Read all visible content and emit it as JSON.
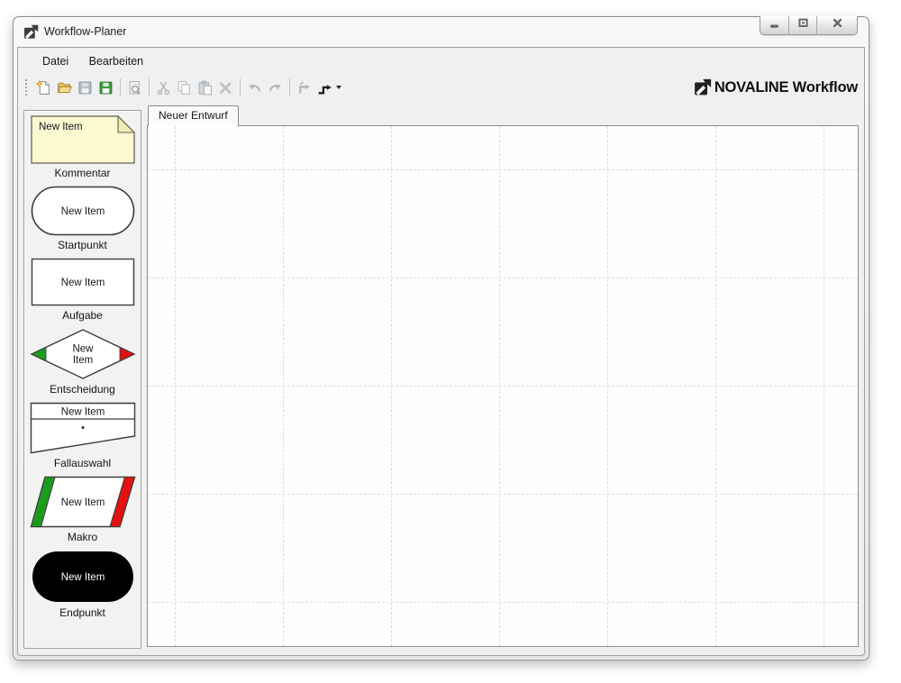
{
  "window": {
    "title": "Workflow-Planer",
    "controls": [
      {
        "name": "minimize"
      },
      {
        "name": "restore"
      },
      {
        "name": "close"
      }
    ]
  },
  "menu": {
    "items": [
      {
        "label": "Datei"
      },
      {
        "label": "Bearbeiten"
      }
    ]
  },
  "toolbar": {
    "brand": "NOVALINE Workflow",
    "items": [
      {
        "type": "button",
        "icon": "new-document",
        "enabled": true
      },
      {
        "type": "button",
        "icon": "open-folder",
        "enabled": true
      },
      {
        "type": "button",
        "icon": "save",
        "enabled": false
      },
      {
        "type": "button",
        "icon": "save-all",
        "enabled": true
      },
      {
        "type": "separator"
      },
      {
        "type": "button",
        "icon": "print-preview",
        "enabled": false
      },
      {
        "type": "separator"
      },
      {
        "type": "button",
        "icon": "cut",
        "enabled": false
      },
      {
        "type": "button",
        "icon": "copy",
        "enabled": false
      },
      {
        "type": "button",
        "icon": "paste",
        "enabled": false
      },
      {
        "type": "button",
        "icon": "delete",
        "enabled": false
      },
      {
        "type": "separator"
      },
      {
        "type": "button",
        "icon": "undo",
        "enabled": false
      },
      {
        "type": "button",
        "icon": "redo",
        "enabled": false
      },
      {
        "type": "separator"
      },
      {
        "type": "button",
        "icon": "reroute-connector",
        "enabled": false
      },
      {
        "type": "button",
        "icon": "connector-style",
        "enabled": true,
        "dropdown": true
      }
    ]
  },
  "document_tabs": {
    "active": "Neuer Entwurf"
  },
  "palette": {
    "colors": {
      "note_fill": "#fbf9d0",
      "note_fold": "#efecb2",
      "green": "#1d9b1d",
      "red": "#e11212",
      "endpoint_fill": "#000000",
      "shape_stroke": "#3c3c3c"
    },
    "items": [
      {
        "key": "kommentar",
        "shape": "note",
        "label": "New Item",
        "caption": "Kommentar"
      },
      {
        "key": "startpunkt",
        "shape": "stadium",
        "label": "New Item",
        "caption": "Startpunkt"
      },
      {
        "key": "aufgabe",
        "shape": "rectangle",
        "label": "New Item",
        "caption": "Aufgabe"
      },
      {
        "key": "entscheidung",
        "shape": "diamond",
        "label": "New Item",
        "caption": "Entscheidung"
      },
      {
        "key": "fallauswahl",
        "shape": "case",
        "label": "New Item",
        "caption": "Fallauswahl"
      },
      {
        "key": "makro",
        "shape": "parallelogram",
        "label": "New Item",
        "caption": "Makro"
      },
      {
        "key": "endpunkt",
        "shape": "endpoint",
        "label": "New Item",
        "caption": "Endpunkt"
      }
    ]
  }
}
